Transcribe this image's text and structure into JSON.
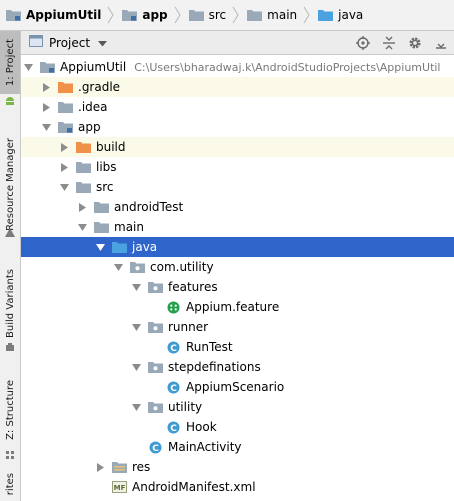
{
  "breadcrumb": [
    {
      "label": "AppiumUtil",
      "icon": "module-folder-icon",
      "bold": true
    },
    {
      "label": "app",
      "icon": "module-folder-icon",
      "bold": true
    },
    {
      "label": "src",
      "icon": "folder-icon",
      "bold": false
    },
    {
      "label": "main",
      "icon": "folder-icon",
      "bold": false
    },
    {
      "label": "java",
      "icon": "source-folder-icon",
      "bold": false
    }
  ],
  "left_tabs": {
    "project": "1: Project",
    "resource_manager": "Resource Manager",
    "build_variants": "Build Variants",
    "structure": "Z: Structure",
    "favorites": "rites"
  },
  "panel": {
    "view_label": "Project",
    "tool_icons": [
      "locate-icon",
      "collapse-all-icon",
      "settings-gear-icon",
      "hide-icon"
    ]
  },
  "tree": [
    {
      "label": "AppiumUtil",
      "path": "C:\\Users\\bharadwaj.k\\AndroidStudioProjects\\AppiumUtil",
      "level": 0,
      "expanded": true,
      "icon": "module-folder-icon",
      "bold": false
    },
    {
      "label": ".gradle",
      "level": 1,
      "expanded": false,
      "icon": "excluded-folder-icon",
      "highlight": true
    },
    {
      "label": ".idea",
      "level": 1,
      "expanded": false,
      "icon": "folder-icon"
    },
    {
      "label": "app",
      "level": 1,
      "expanded": true,
      "icon": "module-folder-icon"
    },
    {
      "label": "build",
      "level": 2,
      "expanded": false,
      "icon": "excluded-folder-icon",
      "highlight": true
    },
    {
      "label": "libs",
      "level": 2,
      "expanded": false,
      "icon": "folder-icon"
    },
    {
      "label": "src",
      "level": 2,
      "expanded": true,
      "icon": "folder-icon"
    },
    {
      "label": "androidTest",
      "level": 3,
      "expanded": false,
      "icon": "folder-icon"
    },
    {
      "label": "main",
      "level": 3,
      "expanded": true,
      "icon": "folder-icon"
    },
    {
      "label": "java",
      "level": 4,
      "expanded": true,
      "icon": "source-folder-icon",
      "selected": true
    },
    {
      "label": "com.utility",
      "level": 5,
      "expanded": true,
      "icon": "package-icon"
    },
    {
      "label": "features",
      "level": 6,
      "expanded": true,
      "icon": "package-icon"
    },
    {
      "label": "Appium.feature",
      "level": 7,
      "icon": "cucumber-feature-icon"
    },
    {
      "label": "runner",
      "level": 6,
      "expanded": true,
      "icon": "package-icon"
    },
    {
      "label": "RunTest",
      "level": 7,
      "icon": "class-icon"
    },
    {
      "label": "stepdefinations",
      "level": 6,
      "expanded": true,
      "icon": "package-icon"
    },
    {
      "label": "AppiumScenario",
      "level": 7,
      "icon": "class-icon"
    },
    {
      "label": "utility",
      "level": 6,
      "expanded": true,
      "icon": "package-icon"
    },
    {
      "label": "Hook",
      "level": 7,
      "icon": "class-icon"
    },
    {
      "label": "MainActivity",
      "level": 6,
      "icon": "class-icon"
    },
    {
      "label": "res",
      "level": 4,
      "expanded": false,
      "icon": "resources-folder-icon"
    },
    {
      "label": "AndroidManifest.xml",
      "level": 4,
      "icon": "manifest-file-icon"
    }
  ],
  "colors": {
    "selection": "#2f65ca",
    "highlight": "#fbfae8",
    "folder": "#8fa8c2",
    "source_folder": "#4aa3e0",
    "excluded_folder": "#f0914a",
    "class_icon": "#3f9bd3",
    "cucumber_icon": "#23a04a"
  }
}
